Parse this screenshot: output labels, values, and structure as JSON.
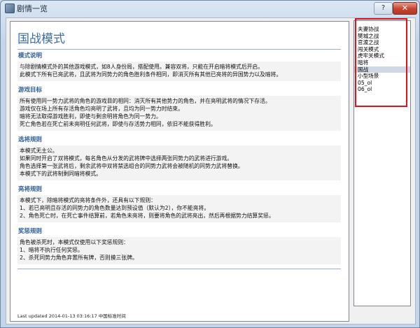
{
  "window": {
    "title": "剧情一览",
    "help_label": "?",
    "close_label": "✕"
  },
  "document": {
    "title": "国战模式",
    "sections": [
      {
        "heading": "模式说明",
        "lines": [
          "与除剧情模式外的其他游戏模式，如8人身份局，搭配使用。兼容双将，只能在开启暗将模式后开启。",
          "此模式下所有已亮武将，且武将为同势力的角色胜利条件相同，即消灭所有其他已亮将的异国势力以及暗将。"
        ]
      },
      {
        "heading": "游戏目标",
        "lines": [
          "所有使用同一势力武将的角色的游戏目的相同：消灭所有其他势力的角色，并在亮明武将的情况下存活。",
          "游戏仅在场上所有存活角色均亮明了武将，且均为同一势力时结束。",
          "暗将无法取得游戏胜利，即使与剩余明将角色为同一势力。",
          "死亡角色若在死亡前未亮明任何武将，即使与存活势力相同，依旧不能获得胜利。"
        ]
      },
      {
        "heading": "选将规则",
        "lines": [
          "本模式无主公。",
          "如果同时开启了双将模式，每名角色从分发的武将牌中选择两张同势力的武将进行游戏。",
          "角色选择第一张武将后，剩余武将中双将禁选组合的同势力武将会被随机的同势力武将替换。",
          "本模式下的武将制剩同暗将模式。"
        ]
      },
      {
        "heading": "亮将规则",
        "lines": [
          "本模式下，除暗将模式的亮将条件外，还具有以下规则：",
          "1、若已亮明且存活的同势力的角色数量达到预设值（默认为2），你不能亮将。",
          "2、角色死亡时，在死亡事件结算前，若角色未亮将，则要将角色的武将亮出，然后再根据势力结算奖惩。"
        ]
      },
      {
        "heading": "奖惩规则",
        "lines": [
          "角色被杀死时，本模式仅使用以下奖惩规则：",
          "1、暗将不执行任何奖惩。",
          "2、杀死同势力角色弃置所有牌，否则摸三张牌。"
        ]
      }
    ],
    "footer": "Last updated 2014-01-13 03:16:17 中国标准时间"
  },
  "list": {
    "items": [
      "夫妻协战",
      "樊城之战",
      "官渡之战",
      "闯关模式",
      "虎牢关模式",
      "暗将",
      "国战",
      "小型场景",
      "05_ol",
      "06_ol"
    ],
    "selected_index": 6
  }
}
